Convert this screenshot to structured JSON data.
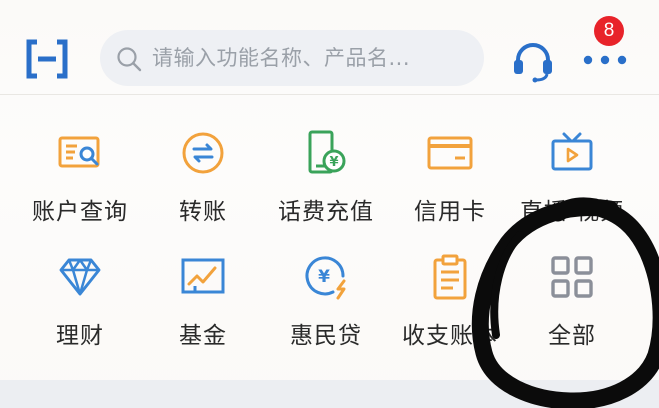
{
  "header": {
    "search_placeholder": "请输入功能名称、产品名...",
    "badge_count": "8",
    "icons": {
      "scan": "scan-icon",
      "search": "search-icon",
      "support": "headset-icon",
      "more": "more-dots-icon"
    }
  },
  "colors": {
    "orange": "#f2a23c",
    "green": "#3aa35a",
    "blue": "#3a86d6",
    "gray": "#8b8f99",
    "badge": "#e8232a",
    "annotation": "#0b0b0b"
  },
  "grid": [
    {
      "label": "账户查询",
      "icon": "account-query-icon"
    },
    {
      "label": "转账",
      "icon": "transfer-icon"
    },
    {
      "label": "话费充值",
      "icon": "phone-recharge-icon"
    },
    {
      "label": "信用卡",
      "icon": "credit-card-icon"
    },
    {
      "label": "直播·视频",
      "icon": "live-video-icon"
    },
    {
      "label": "理财",
      "icon": "wealth-diamond-icon"
    },
    {
      "label": "基金",
      "icon": "fund-chart-icon"
    },
    {
      "label": "惠民贷",
      "icon": "loan-icon"
    },
    {
      "label": "收支账本",
      "icon": "ledger-icon"
    },
    {
      "label": "全部",
      "icon": "all-grid-icon"
    }
  ]
}
